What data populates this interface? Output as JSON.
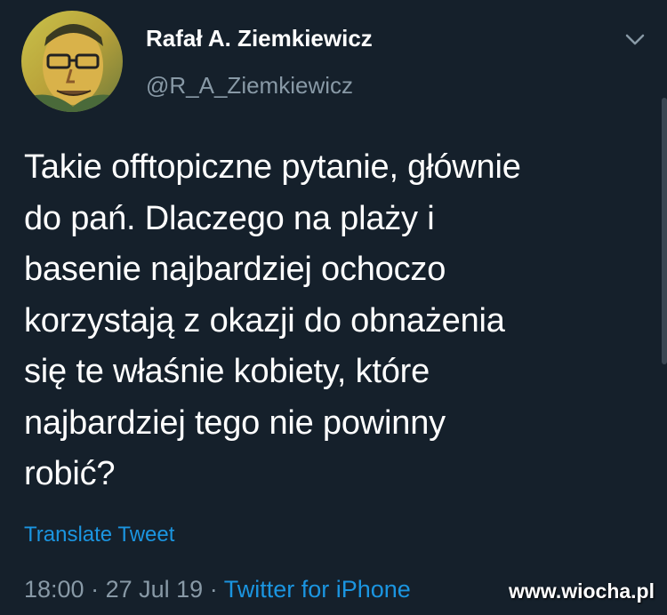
{
  "tweet": {
    "author": {
      "display_name": "Rafał A. Ziemkiewicz",
      "handle": "@R_A_Ziemkiewicz",
      "avatar_icon": "avatar-portrait"
    },
    "text": "Takie offtopiczne pytanie, głównie\ndo pań. Dlaczego na plaży i\nbasenie najbardziej ochoczo\nkorzystają z okazji do obnażenia\nsię te właśnie kobiety, które\nnajbardziej tego nie powinny\nrobić?",
    "translate_label": "Translate Tweet",
    "time": "18:00",
    "separator": "·",
    "date": "27 Jul 19",
    "source": "Twitter for iPhone",
    "menu_icon": "chevron-down-icon"
  },
  "watermark": "www.wiocha.pl",
  "colors": {
    "background": "#15202b",
    "text": "#ffffff",
    "secondary": "#8899a6",
    "link": "#1b95e0"
  }
}
